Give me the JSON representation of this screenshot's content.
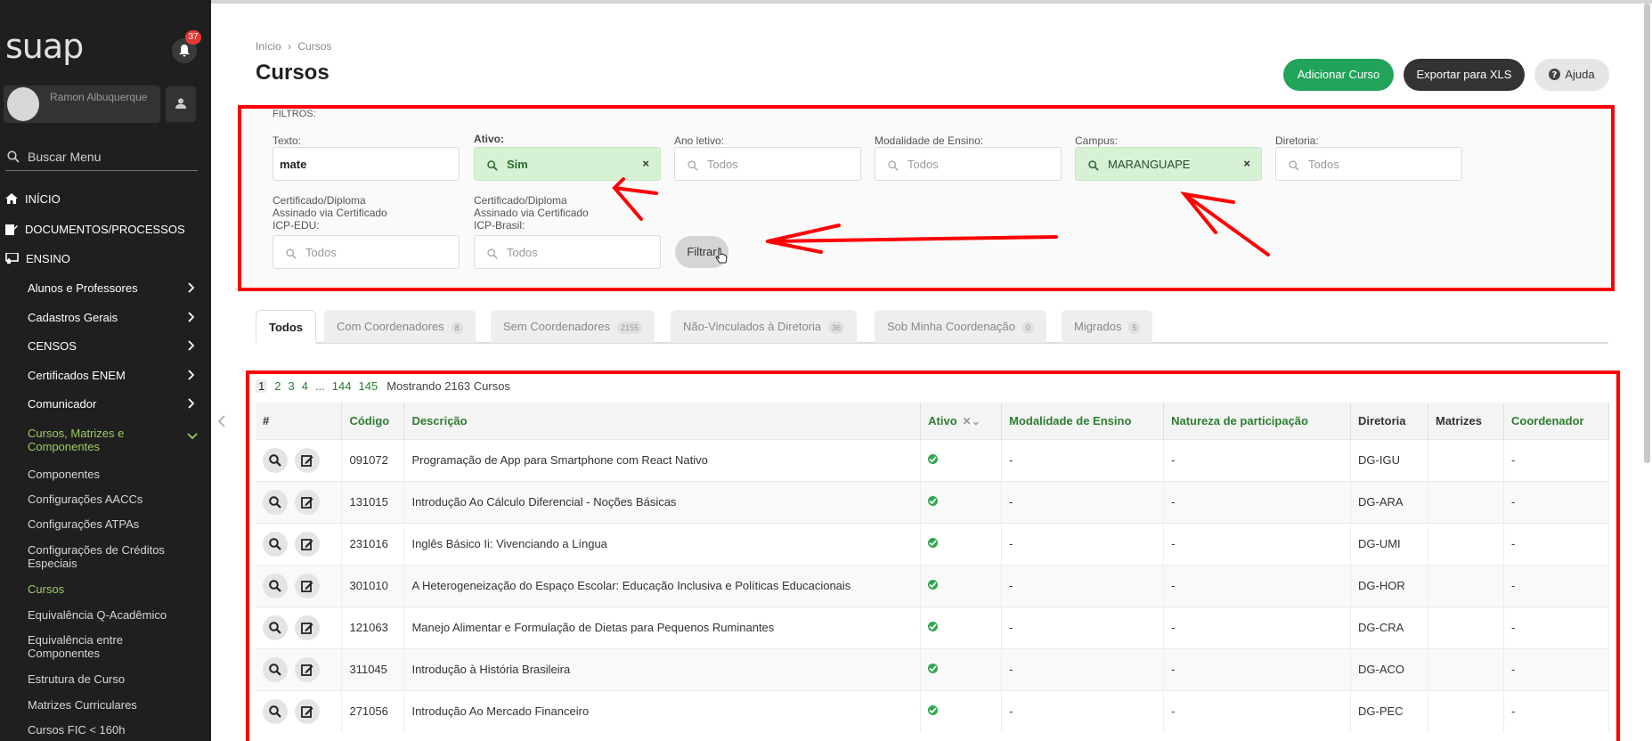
{
  "sidebar": {
    "logo": "suap",
    "notifications": "37",
    "user_name": "Ramon Albuquerque",
    "search_placeholder": "Buscar Menu",
    "top_items": [
      "INÍCIO",
      "DOCUMENTOS/PROCESSOS",
      "ENSINO"
    ],
    "ensino_items": [
      "Alunos e Professores",
      "Cadastros Gerais",
      "CENSOS",
      "Certificados ENEM",
      "Comunicador"
    ],
    "expanded_group": "Cursos, Matrizes e Componentes",
    "sub_items": [
      "Componentes",
      "Configurações AACCs",
      "Configurações ATPAs",
      "Configurações de Créditos Especiais",
      "Cursos",
      "Equivalência Q-Acadêmico",
      "Equivalência entre Componentes",
      "Estrutura de Curso",
      "Matrizes Curriculares",
      "Cursos FIC < 160h"
    ]
  },
  "header": {
    "breadcrumb_home": "Início",
    "breadcrumb_sep": "›",
    "breadcrumb_current": "Cursos",
    "title": "Cursos",
    "btn_add": "Adicionar Curso",
    "btn_export": "Exportar para XLS",
    "btn_help": "Ajuda"
  },
  "filters": {
    "title": "FILTROS:",
    "texto_label": "Texto:",
    "texto_value": "mate",
    "ativo_label": "Ativo:",
    "ativo_value": "Sim",
    "ano_label": "Ano letivo:",
    "ano_placeholder": "Todos",
    "modalidade_label": "Modalidade de Ensino:",
    "modalidade_placeholder": "Todos",
    "campus_label": "Campus:",
    "campus_value": "MARANGUAPE",
    "diretoria_label": "Diretoria:",
    "diretoria_placeholder": "Todos",
    "icp_edu_label": "Certificado/Diploma Assinado via Certificado ICP-EDU:",
    "icp_edu_placeholder": "Todos",
    "icp_brasil_label": "Certificado/Diploma Assinado via Certificado ICP-Brasil:",
    "icp_brasil_placeholder": "Todos",
    "clear_symbol": "×",
    "btn_filtrar": "Filtrar"
  },
  "tabs": [
    {
      "label": "Todos",
      "count": ""
    },
    {
      "label": "Com Coordenadores",
      "count": "8"
    },
    {
      "label": "Sem Coordenadores",
      "count": "2155"
    },
    {
      "label": "Não-Vinculados à Diretoria",
      "count": "36"
    },
    {
      "label": "Sob Minha Coordenação",
      "count": "0"
    },
    {
      "label": "Migrados",
      "count": "5"
    }
  ],
  "pagination": {
    "pages": [
      "1",
      "2",
      "3",
      "4",
      "...",
      "144",
      "145"
    ],
    "info": "Mostrando 2163 Cursos"
  },
  "table": {
    "headers": [
      "#",
      "Código",
      "Descrição",
      "Ativo",
      "Modalidade de Ensino",
      "Natureza de participação",
      "Diretoria",
      "Matrizes",
      "Coordenador"
    ],
    "rows": [
      {
        "codigo": "091072",
        "descricao": "Programação de App para Smartphone com React Nativo",
        "modalidade": "-",
        "natureza": "-",
        "diretoria": "DG-IGU",
        "matrizes": "",
        "coordenador": "-"
      },
      {
        "codigo": "131015",
        "descricao": "Introdução Ao Cálculo Diferencial - Noções Básicas",
        "modalidade": "-",
        "natureza": "-",
        "diretoria": "DG-ARA",
        "matrizes": "",
        "coordenador": "-"
      },
      {
        "codigo": "231016",
        "descricao": "Inglês Básico Ii: Vivenciando a Língua",
        "modalidade": "-",
        "natureza": "-",
        "diretoria": "DG-UMI",
        "matrizes": "",
        "coordenador": "-"
      },
      {
        "codigo": "301010",
        "descricao": "A Heterogeneização do Espaço Escolar: Educação Inclusiva e Políticas Educacionais",
        "modalidade": "-",
        "natureza": "-",
        "diretoria": "DG-HOR",
        "matrizes": "",
        "coordenador": "-"
      },
      {
        "codigo": "121063",
        "descricao": "Manejo Alimentar e Formulação de Dietas para Pequenos Ruminantes",
        "modalidade": "-",
        "natureza": "-",
        "diretoria": "DG-CRA",
        "matrizes": "",
        "coordenador": "-"
      },
      {
        "codigo": "311045",
        "descricao": "Introdução à História Brasileira",
        "modalidade": "-",
        "natureza": "-",
        "diretoria": "DG-ACO",
        "matrizes": "",
        "coordenador": "-"
      },
      {
        "codigo": "271056",
        "descricao": "Introdução Ao Mercado Financeiro",
        "modalidade": "-",
        "natureza": "-",
        "diretoria": "DG-PEC",
        "matrizes": "",
        "coordenador": "-"
      }
    ]
  },
  "colors": {
    "accent": "#22a35a",
    "annotation": "#ff0000",
    "sidebar_bg": "#1f1f1f"
  }
}
